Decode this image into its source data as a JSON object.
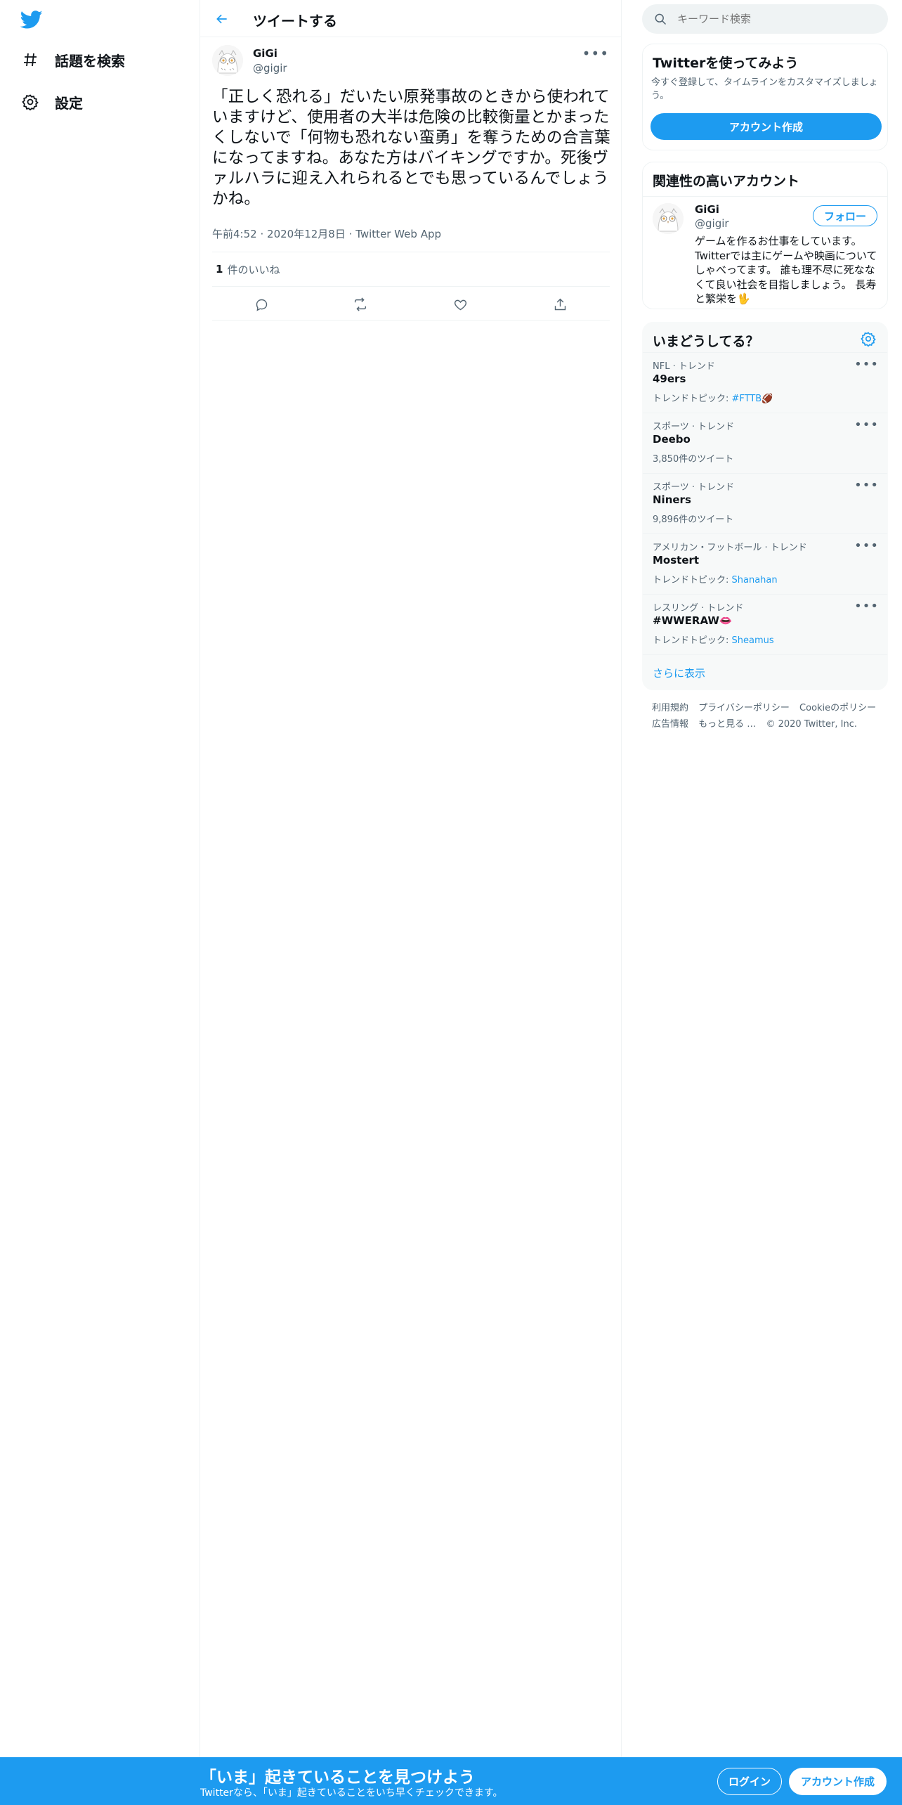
{
  "colors": {
    "accent": "#1d9bf0",
    "text": "#0f1419",
    "secondary": "#536471",
    "border": "#eff3f4"
  },
  "sidebar": {
    "logo": "twitter-bird-icon",
    "items": [
      {
        "label": "話題を検索",
        "icon": "hashtag-icon"
      },
      {
        "label": "設定",
        "icon": "gear-icon"
      }
    ]
  },
  "header": {
    "title": "ツイートする",
    "back_icon": "back-arrow-icon"
  },
  "tweet": {
    "author_name": "GiGi",
    "author_handle": "@gigir",
    "text": "「正しく恐れる」だいたい原発事故のときから使われていますけど、使用者の大半は危険の比較衡量とかまったくしないで「何物も恐れない蛮勇」を奪うための合言葉になってますね。あなた方はバイキングですか。死後ヴァルハラに迎え入れられるとでも思っているんでしょうかね。",
    "time": "午前4:52",
    "date": "2020年12月8日",
    "source": "Twitter Web App",
    "separator": "·",
    "likes_count": "1",
    "likes_label": "件のいいね"
  },
  "search": {
    "placeholder": "キーワード検索"
  },
  "signup_card": {
    "title": "Twitterを使ってみよう",
    "desc": "今すぐ登録して、タイムラインをカスタマイズしましょう。",
    "button": "アカウント作成"
  },
  "related": {
    "title": "関連性の高いアカウント",
    "name": "GiGi",
    "handle": "@gigir",
    "follow": "フォロー",
    "bio": "ゲームを作るお仕事をしています。 Twitterでは主にゲームや映画についてしゃべってます。 誰も理不尽に死ななくて良い社会を目指しましょう。 長寿と繁栄を🖖"
  },
  "trends": {
    "title": "いまどうしてる？",
    "items": [
      {
        "category": "NFL · トレンド",
        "name": "49ers",
        "sub_prefix": "トレンドトピック: ",
        "sub_link": "#FTTB🏈"
      },
      {
        "category": "スポーツ · トレンド",
        "name": "Deebo",
        "sub_prefix": "3,850件のツイート",
        "sub_link": ""
      },
      {
        "category": "スポーツ · トレンド",
        "name": "Niners",
        "sub_prefix": "9,896件のツイート",
        "sub_link": ""
      },
      {
        "category": "アメリカン・フットボール · トレンド",
        "name": "Mostert",
        "sub_prefix": "トレンドトピック: ",
        "sub_link": "Shanahan"
      },
      {
        "category": "レスリング · トレンド",
        "name": "#WWERAW👄",
        "sub_prefix": "トレンドトピック: ",
        "sub_link": "Sheamus"
      }
    ],
    "show_more": "さらに表示"
  },
  "footer": {
    "links": [
      "利用規約",
      "プライバシーポリシー",
      "Cookieのポリシー",
      "広告情報",
      "もっと見る …",
      "© 2020 Twitter, Inc."
    ]
  },
  "bottom_bar": {
    "title": "「いま」起きていることを見つけよう",
    "subtitle": "Twitterなら、「いま」起きていることをいち早くチェックできます。",
    "login": "ログイン",
    "signup": "アカウント作成"
  }
}
